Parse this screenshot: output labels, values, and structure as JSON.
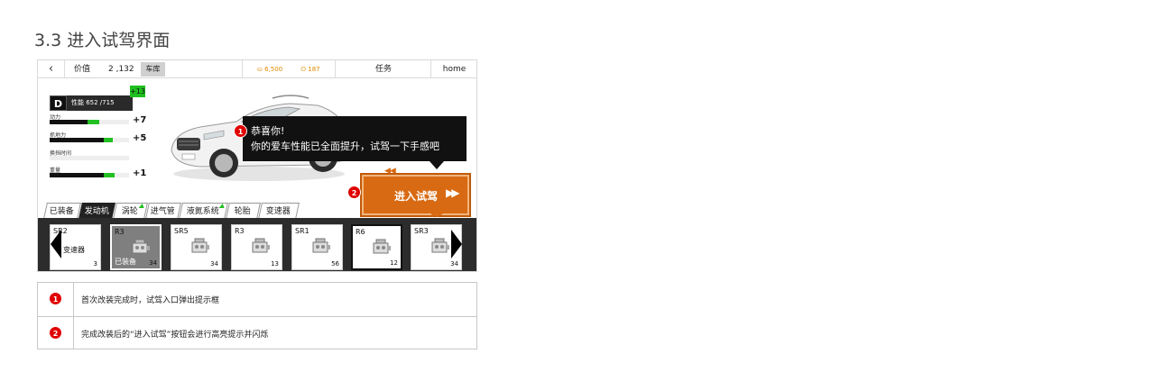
{
  "page": {
    "heading": "3.3 进入试驾界面"
  },
  "topbar": {
    "back_icon": "chevron-left-icon",
    "value_label": "价值",
    "value": "2 ,132",
    "garage_label": "车库",
    "gold": "6,500",
    "gems": "187",
    "task_label": "任务",
    "home_label": "home"
  },
  "car": {
    "rank": "D",
    "performance": "性能 652 /715",
    "boost": "+13",
    "stats": [
      {
        "label": "动力",
        "delta": "+7",
        "base": 0.48,
        "gain": 0.14
      },
      {
        "label": "抓地力",
        "delta": "+5",
        "base": 0.68,
        "gain": 0.12
      },
      {
        "label": "换挡时间",
        "delta": "",
        "base": 0.0,
        "gain": 0.0
      },
      {
        "label": "重量",
        "delta": "+1",
        "base": 0.68,
        "gain": 0.14
      }
    ]
  },
  "popup": {
    "marker": "1",
    "title": "恭喜你!",
    "body": "你的爱车性能已全面提升，试驾一下手感吧"
  },
  "drive_button": {
    "marker": "2",
    "label": "进入试驾",
    "icon": "fast-forward-icon"
  },
  "tabs": [
    {
      "label": "已装备",
      "active": false,
      "new": false
    },
    {
      "label": "发动机",
      "active": true,
      "new": false
    },
    {
      "label": "涡轮",
      "active": false,
      "new": true
    },
    {
      "label": "进气管",
      "active": false,
      "new": false
    },
    {
      "label": "液氮系统",
      "active": false,
      "new": true
    },
    {
      "label": "轮胎",
      "active": false,
      "new": false
    },
    {
      "label": "变速器",
      "active": false,
      "new": false
    }
  ],
  "parts": [
    {
      "name": "SR2",
      "sub": "变速器",
      "count": "3"
    },
    {
      "name": "R3",
      "status": "已装备",
      "count": "34"
    },
    {
      "name": "SR5",
      "count": "34"
    },
    {
      "name": "R3",
      "count": "13"
    },
    {
      "name": "SR1",
      "count": "56"
    },
    {
      "name": "R6",
      "count": "12"
    },
    {
      "name": "SR3",
      "count": "34"
    }
  ],
  "notes": [
    {
      "marker": "1",
      "text": "首次改装完成时，试驾入口弹出提示框"
    },
    {
      "marker": "2",
      "text": "完成改装后的“进入试驾”按钮会进行高亮提示并闪烁"
    }
  ],
  "colors": {
    "accent": "#d86a13",
    "badge": "#e00000",
    "boost": "#22c022"
  }
}
